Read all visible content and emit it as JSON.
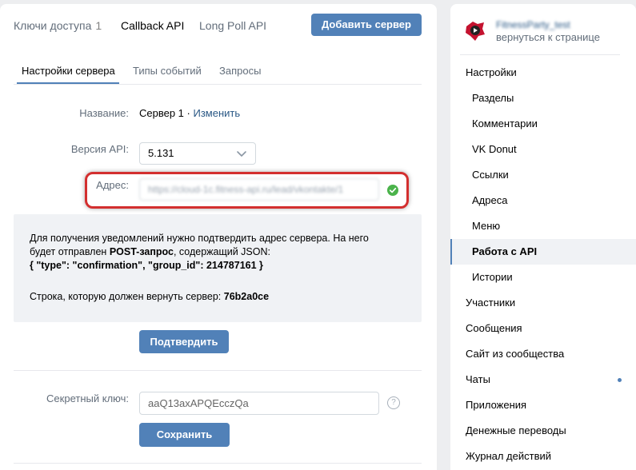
{
  "top_tabs": [
    {
      "label": "Ключи доступа",
      "count": "1"
    },
    {
      "label": "Callback API"
    },
    {
      "label": "Long Poll API"
    }
  ],
  "add_server_button": "Добавить сервер",
  "sub_tabs": [
    "Настройки сервера",
    "Типы событий",
    "Запросы"
  ],
  "form": {
    "name_label": "Название:",
    "name_value": "Сервер 1",
    "name_separator": " · ",
    "edit_link": "Изменить",
    "api_version_label": "Версия API:",
    "api_version_value": "5.131",
    "address_label": "Адрес:",
    "address_value": "https://cloud-1c.fitness-api.ru/lead/vkontakte/1"
  },
  "info": {
    "line1": "Для получения уведомлений нужно подтвердить адрес сервера. На него",
    "line2_pre": "будет отправлен ",
    "line2_bold": "POST-запрос",
    "line2_post": ", содержащий JSON:",
    "line3": "{ \"type\": \"confirmation\", \"group_id\": 214787161 }",
    "line4_pre": "Строка, которую должен вернуть сервер: ",
    "line4_bold": "76b2a0ce"
  },
  "confirm_button": "Подтвердить",
  "secret": {
    "label": "Секретный ключ:",
    "value": "aaQ13axAPQEcczQa",
    "help": "?"
  },
  "save_button": "Сохранить",
  "sidebar": {
    "community_name": "FitnessParty_test",
    "back_link": "вернуться к странице",
    "items": [
      {
        "label": "Настройки",
        "level": "top"
      },
      {
        "label": "Разделы",
        "level": "sub"
      },
      {
        "label": "Комментарии",
        "level": "sub"
      },
      {
        "label": "VK Donut",
        "level": "sub"
      },
      {
        "label": "Ссылки",
        "level": "sub"
      },
      {
        "label": "Адреса",
        "level": "sub"
      },
      {
        "label": "Меню",
        "level": "sub"
      },
      {
        "label": "Работа с API",
        "level": "sub",
        "active": true
      },
      {
        "label": "Истории",
        "level": "sub"
      },
      {
        "label": "Участники",
        "level": "top"
      },
      {
        "label": "Сообщения",
        "level": "top"
      },
      {
        "label": "Сайт из сообщества",
        "level": "top"
      },
      {
        "label": "Чаты",
        "level": "top",
        "dot": true
      },
      {
        "label": "Приложения",
        "level": "top"
      },
      {
        "label": "Денежные переводы",
        "level": "top"
      },
      {
        "label": "Журнал действий",
        "level": "top"
      }
    ]
  },
  "colors": {
    "accent": "#5181b8",
    "link": "#2a5885",
    "highlight_border": "#d32f2f",
    "success": "#4bb34b"
  }
}
